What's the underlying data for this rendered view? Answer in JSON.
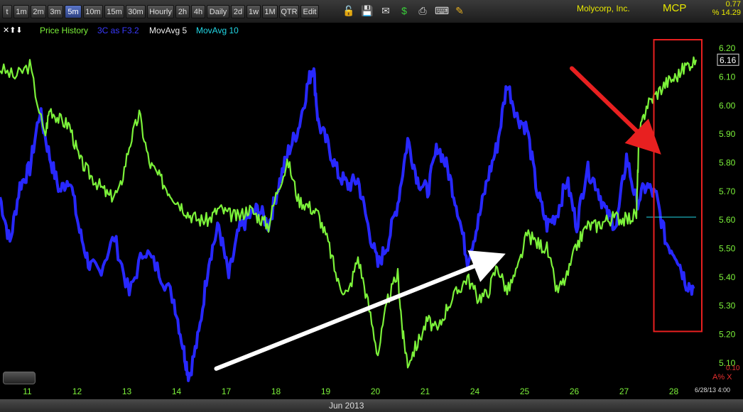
{
  "toolbar": {
    "timeframes": [
      "t",
      "1m",
      "2m",
      "3m",
      "5m",
      "10m",
      "15m",
      "30m",
      "Hourly",
      "2h",
      "4h",
      "Daily",
      "2d",
      "1w",
      "1M",
      "QTR",
      "Edit"
    ],
    "active": "5m",
    "icons": [
      "lock-icon",
      "save-icon",
      "mail-icon",
      "dollar-icon",
      "print-icon",
      "keyboard-icon",
      "pencil-icon"
    ]
  },
  "header": {
    "company": "Molycorp, Inc.",
    "symbol": "MCP",
    "change": "0.77",
    "change_pct": "% 14.29"
  },
  "legend": {
    "arrows": "✕⬆⬇",
    "price_history": "Price History",
    "indicator": "3C as F3.2",
    "mavg5": "MovAvg 5",
    "mavg10": "MovAvg 10"
  },
  "colors": {
    "price": "#7cf23a",
    "indicator": "#2828ff",
    "mavg10": "#22d8e6",
    "annotation_box": "#e82020",
    "arrow_red": "#e82020",
    "arrow_white": "#ffffff",
    "axis_text": "#7cf23a"
  },
  "chart_data": {
    "type": "line",
    "title": "",
    "xlabel": "Jun 2013",
    "ylabel": "",
    "ylim": [
      5.03,
      6.23
    ],
    "categories": [
      "11",
      "12",
      "13",
      "14",
      "17",
      "18",
      "19",
      "20",
      "21",
      "24",
      "25",
      "26",
      "27",
      "28"
    ],
    "yticks": [
      "6.20",
      "6.10",
      "6.00",
      "5.90",
      "5.80",
      "5.70",
      "5.60",
      "5.50",
      "5.40",
      "5.30",
      "5.20",
      "5.10"
    ],
    "last_price": "6.16",
    "lower_value": "0.10",
    "lower_label": "A",
    "lower_label2": "% X",
    "date_stamp": "6/28/13 4:00",
    "grid": false,
    "series": [
      {
        "name": "Price History",
        "x": [
          0,
          0.3,
          0.6,
          0.9,
          1.0,
          1.2,
          1.4,
          1.6,
          1.8,
          2.0,
          2.2,
          2.4,
          2.6,
          2.8,
          3.0,
          3.2,
          3.4,
          3.6,
          3.8,
          4.0,
          4.2,
          4.4,
          4.6,
          4.8,
          5.0,
          5.2,
          5.4,
          5.6,
          5.8,
          6.0,
          6.2,
          6.4,
          6.6,
          6.8,
          7.0,
          7.2,
          7.4,
          7.6,
          7.8,
          8.0,
          8.1,
          8.2,
          8.4,
          8.6,
          8.8,
          9.0,
          9.2,
          9.4,
          9.6,
          9.8,
          10.0,
          10.2,
          10.4,
          10.6,
          10.8,
          11.0,
          11.2,
          11.4,
          11.6,
          11.8,
          12.0,
          12.2,
          12.4,
          12.6,
          12.8,
          12.85,
          13.0,
          13.2,
          13.4,
          13.6,
          13.8,
          14.0
        ],
        "values": [
          6.13,
          6.1,
          6.14,
          5.89,
          5.99,
          5.95,
          5.93,
          5.81,
          5.76,
          5.72,
          5.68,
          5.7,
          5.86,
          5.97,
          5.8,
          5.75,
          5.7,
          5.66,
          5.62,
          5.6,
          5.6,
          5.64,
          5.62,
          5.61,
          5.64,
          5.61,
          5.58,
          5.72,
          5.8,
          5.67,
          5.65,
          5.62,
          5.52,
          5.38,
          5.34,
          5.47,
          5.31,
          5.13,
          5.32,
          5.41,
          5.2,
          5.1,
          5.17,
          5.25,
          5.21,
          5.3,
          5.35,
          5.4,
          5.33,
          5.34,
          5.44,
          5.35,
          5.42,
          5.55,
          5.52,
          5.5,
          5.35,
          5.4,
          5.51,
          5.58,
          5.58,
          5.6,
          5.61,
          5.6,
          5.62,
          5.89,
          6.0,
          6.04,
          6.08,
          6.1,
          6.14,
          6.16
        ]
      },
      {
        "name": "3C as F3.2",
        "x": [
          0,
          0.2,
          0.4,
          0.6,
          0.8,
          1.0,
          1.2,
          1.4,
          1.6,
          1.8,
          2.0,
          2.3,
          2.6,
          2.9,
          3.2,
          3.5,
          3.7,
          3.8,
          4.0,
          4.2,
          4.4,
          4.6,
          4.8,
          5.0,
          5.2,
          5.4,
          5.6,
          5.8,
          6.0,
          6.2,
          6.3,
          6.4,
          6.6,
          6.8,
          7.0,
          7.2,
          7.4,
          7.6,
          7.8,
          8.0,
          8.2,
          8.4,
          8.6,
          8.8,
          9.0,
          9.2,
          9.4,
          9.6,
          9.8,
          10.0,
          10.2,
          10.4,
          10.6,
          10.8,
          11.0,
          11.2,
          11.4,
          11.6,
          11.8,
          12.0,
          12.2,
          12.4,
          12.6,
          12.8,
          13.0,
          13.2,
          13.4,
          13.6,
          13.8,
          13.95
        ],
        "values": [
          5.68,
          5.52,
          5.72,
          5.78,
          5.98,
          5.82,
          5.7,
          5.75,
          5.56,
          5.44,
          5.42,
          5.54,
          5.34,
          5.5,
          5.42,
          5.32,
          5.14,
          5.05,
          5.2,
          5.46,
          5.58,
          5.4,
          5.56,
          5.61,
          5.64,
          5.58,
          5.72,
          5.84,
          5.92,
          6.08,
          6.14,
          5.94,
          5.86,
          5.76,
          5.72,
          5.74,
          5.58,
          5.44,
          5.52,
          5.66,
          5.88,
          5.74,
          5.7,
          5.86,
          5.78,
          5.64,
          5.46,
          5.58,
          5.74,
          5.86,
          6.08,
          5.96,
          5.92,
          5.7,
          5.58,
          5.62,
          5.74,
          5.58,
          5.78,
          5.72,
          5.62,
          5.58,
          5.82,
          5.66,
          5.72,
          5.68,
          5.52,
          5.48,
          5.38,
          5.36
        ]
      },
      {
        "name": "MovAvg 10",
        "x": [
          13.0,
          14.0
        ],
        "values": [
          5.61,
          5.61
        ]
      }
    ],
    "annotations": [
      {
        "type": "box",
        "x0": 13.15,
        "x1": 14.0,
        "y0": 5.21,
        "y1": 6.23
      },
      {
        "type": "arrow",
        "color": "red",
        "x0": 11.5,
        "y0": 6.13,
        "x1": 13.05,
        "y1": 5.87
      },
      {
        "type": "arrow",
        "color": "white",
        "x0": 4.35,
        "y0": 5.08,
        "x1": 9.85,
        "y1": 5.46
      }
    ]
  }
}
